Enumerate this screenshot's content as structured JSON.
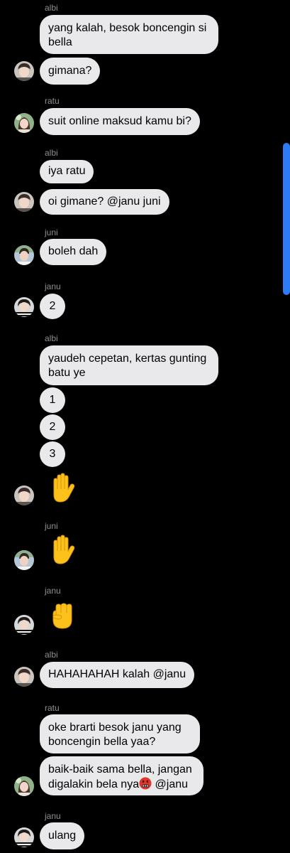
{
  "messages": [
    {
      "sender": "albi",
      "lines": [
        "yang kalah, besok boncengin si",
        "bella"
      ]
    },
    {
      "text": "gimana?"
    },
    {
      "sender": "ratu",
      "text": "suit online maksud kamu bi?"
    },
    {
      "sender": "albi",
      "text": "iya ratu"
    },
    {
      "text": "oi gimane? @janu juni"
    },
    {
      "sender": "juni",
      "text": "boleh dah"
    },
    {
      "sender": "janu",
      "text": "2"
    },
    {
      "sender": "albi",
      "lines": [
        "yaudeh cepetan, kertas gunting",
        "batu ye"
      ]
    },
    {
      "text": "1"
    },
    {
      "text": "2"
    },
    {
      "text": "3"
    },
    {
      "emoji": "raised-hand-emoji"
    },
    {
      "sender": "juni",
      "emoji": "raised-hand-emoji"
    },
    {
      "sender": "janu",
      "emoji": "raised-fist-emoji"
    },
    {
      "sender": "albi",
      "text": "HAHAHAHAH kalah @janu"
    },
    {
      "sender": "ratu",
      "lines": [
        "oke brarti besok janu yang",
        "boncengin bella yaa?"
      ]
    },
    {
      "line1": "baik-baik sama bella, jangan",
      "line2_before": "digalakin bela nya",
      "line2_emoji": "cursing-face-emoji",
      "line2_after": " @janu"
    },
    {
      "sender": "janu",
      "text": "ulang"
    }
  ],
  "colors": {
    "background": "#000000",
    "bubble": "#e9e9eb",
    "sender_text": "#8e8e93",
    "scrollbar": "#2d7cf6"
  }
}
